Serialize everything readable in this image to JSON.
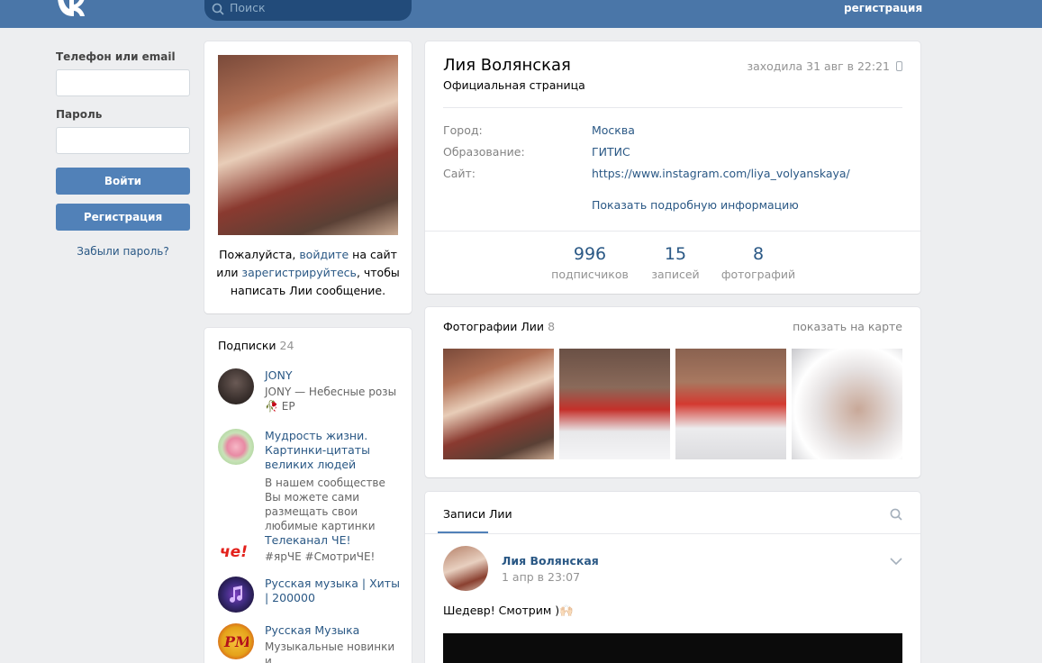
{
  "header": {
    "search_placeholder": "Поиск",
    "register_link": "регистрация"
  },
  "login": {
    "phone_label": "Телефон или email",
    "password_label": "Пароль",
    "login_button": "Войти",
    "register_button": "Регистрация",
    "forgot_link": "Забыли пароль?"
  },
  "avatar_card": {
    "msg_prefix": "Пожалуйста, ",
    "msg_login": "войдите",
    "msg_mid": " на сайт или ",
    "msg_register": "зарегистрируйтесь",
    "msg_suffix": ", чтобы написать Лии сообщение."
  },
  "subscriptions": {
    "title": "Подписки",
    "count": "24",
    "items": [
      {
        "name": "JONY",
        "desc": "JONY — Небесные розы 🥀 EP"
      },
      {
        "name": "Мудрость жизни. Картинки-цитаты великих людей",
        "desc": "В нашем сообществе Вы можете сами размещать свои любимые картинки"
      },
      {
        "name": "Телеканал ЧЕ!",
        "desc": "#ярЧЕ #СмотриЧЕ!"
      },
      {
        "name": "Русская музыка | Хиты | 200000",
        "desc": ""
      },
      {
        "name": "Русская Музыка",
        "desc": "Музыкальные новинки и"
      }
    ]
  },
  "profile": {
    "name": "Лия Волянская",
    "subtitle": "Официальная страница",
    "last_seen": "заходила 31 авг в 22:21",
    "fields": [
      {
        "key": "Город:",
        "value": "Москва"
      },
      {
        "key": "Образование:",
        "value": "ГИТИС"
      },
      {
        "key": "Сайт:",
        "value": "https://www.instagram.com/liya_volyanskaya/"
      }
    ],
    "more_link": "Показать подробную информацию",
    "stats": [
      {
        "num": "996",
        "label": "подписчиков"
      },
      {
        "num": "15",
        "label": "записей"
      },
      {
        "num": "8",
        "label": "фотографий"
      }
    ]
  },
  "photos": {
    "title": "Фотографии Лии",
    "count": "8",
    "map_link": "показать на карте"
  },
  "wall": {
    "tab": "Записи Лии",
    "post": {
      "author": "Лия Волянская",
      "date": "1 апр в 23:07",
      "text": "Шедевр! Смотрим )🙌🏻"
    }
  },
  "colors": {
    "header": "#4a76a8",
    "accent": "#5181b8",
    "link": "#2a5885",
    "background": "#edeef0"
  }
}
